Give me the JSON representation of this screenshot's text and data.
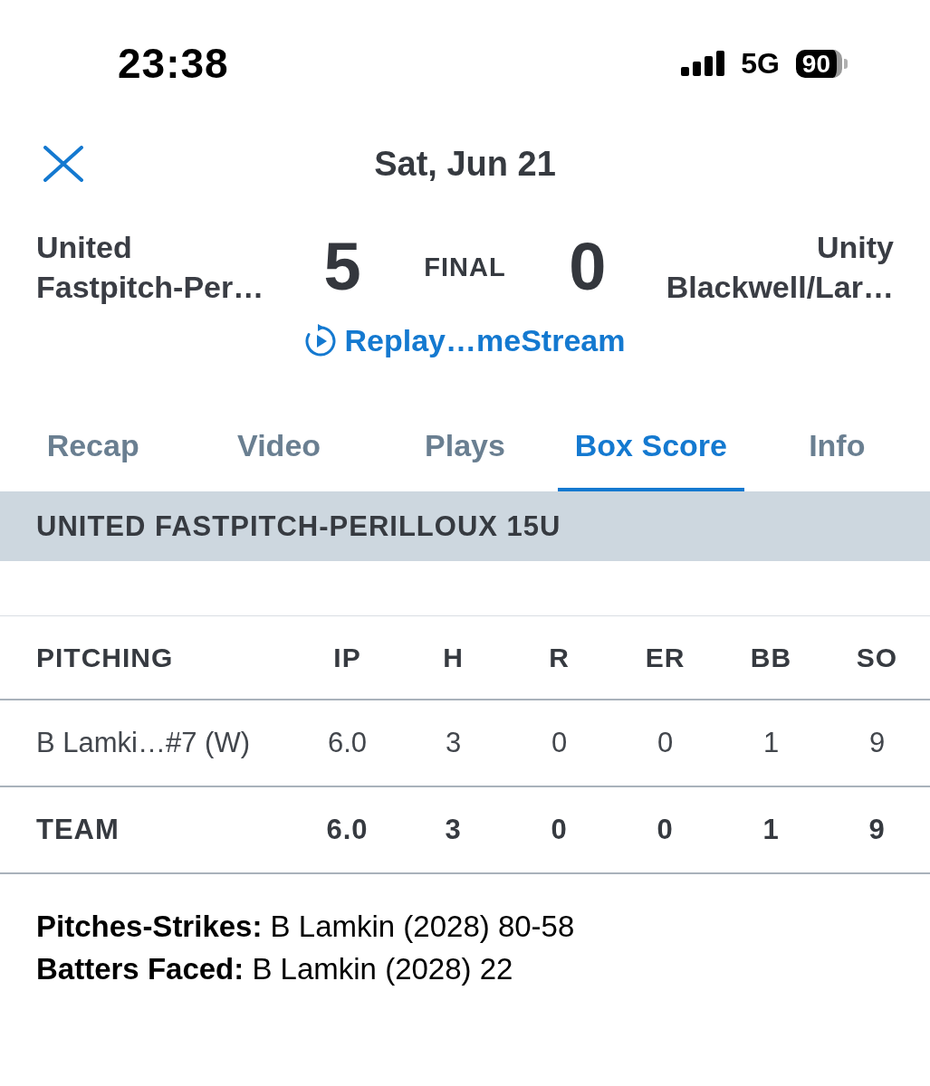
{
  "status_bar": {
    "time": "23:38",
    "network": "5G",
    "battery": "90"
  },
  "header": {
    "title": "Sat, Jun 21"
  },
  "game": {
    "away_team": {
      "name_lines": [
        "United",
        "Fastpitch-Per…"
      ],
      "score": "5"
    },
    "status": "FINAL",
    "home_team": {
      "name_lines": [
        "Unity",
        "Blackwell/Lar…"
      ],
      "score": "0"
    },
    "replay_link": "Replay…meStream"
  },
  "tabs": [
    {
      "label": "Recap",
      "selected": false
    },
    {
      "label": "Video",
      "selected": false
    },
    {
      "label": "Plays",
      "selected": false
    },
    {
      "label": "Box Score",
      "selected": true
    },
    {
      "label": "Info",
      "selected": false
    }
  ],
  "section": {
    "title": "UNITED FASTPITCH-PERILLOUX 15U"
  },
  "table": {
    "columns": [
      "PITCHING",
      "IP",
      "H",
      "R",
      "ER",
      "BB",
      "SO"
    ],
    "rows": [
      {
        "kind": "player",
        "cells": [
          "B Lamki…#7 (W)",
          "6.0",
          "3",
          "0",
          "0",
          "1",
          "9"
        ]
      },
      {
        "kind": "total",
        "cells": [
          "TEAM",
          "6.0",
          "3",
          "0",
          "0",
          "1",
          "9"
        ]
      }
    ]
  },
  "notes": [
    "**Pitches-Strikes:** B Lamkin (2028) 80-58",
    "**Batters Faced:** B Lamkin (2028) 22"
  ]
}
